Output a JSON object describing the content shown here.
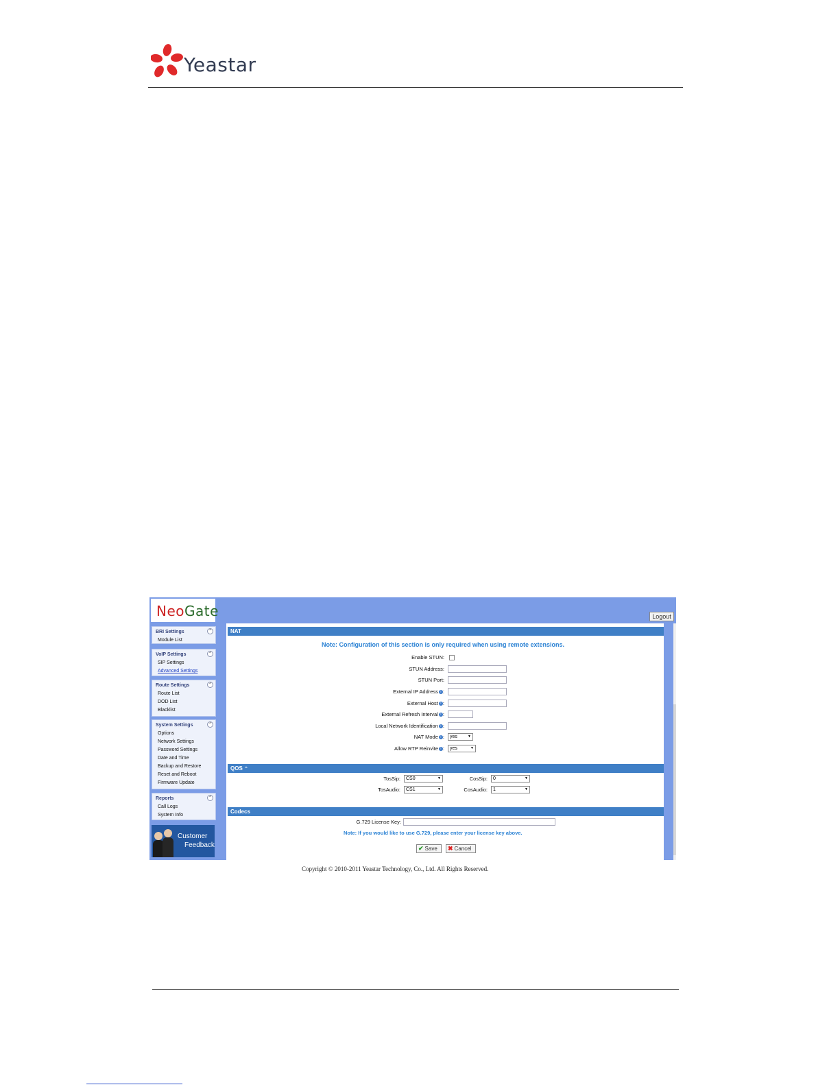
{
  "doc": {
    "brand": "Yeastar",
    "copyright": "Copyright © 2010-2011 Yeastar Technology, Co., Ltd. All Rights Reserved."
  },
  "ui": {
    "product_logo": {
      "part1": "Neo",
      "part2": "Gate"
    },
    "logout_label": "Logout",
    "sidebar": [
      {
        "title": "BRI Settings",
        "items": [
          {
            "label": "Module List",
            "link": false
          }
        ]
      },
      {
        "title": "VoIP Settings",
        "items": [
          {
            "label": "SIP Settings",
            "link": false
          },
          {
            "label": "Advanced Settings",
            "link": true
          }
        ]
      },
      {
        "title": "Route Settings",
        "items": [
          {
            "label": "Route List",
            "link": false
          },
          {
            "label": "DOD List",
            "link": false
          },
          {
            "label": "Blacklist",
            "link": false
          }
        ]
      },
      {
        "title": "System Settings",
        "items": [
          {
            "label": "Options",
            "link": false
          },
          {
            "label": "Network Settings",
            "link": false
          },
          {
            "label": "Password Settings",
            "link": false
          },
          {
            "label": "Date and Time",
            "link": false
          },
          {
            "label": "Backup and Restore",
            "link": false
          },
          {
            "label": "Reset and Reboot",
            "link": false
          },
          {
            "label": "Firmware Update",
            "link": false
          }
        ]
      },
      {
        "title": "Reports",
        "items": [
          {
            "label": "Call Logs",
            "link": false
          },
          {
            "label": "System Info",
            "link": false
          }
        ]
      }
    ],
    "feedback": {
      "line1": "Customer",
      "line2": "Feedback"
    },
    "nat": {
      "title": "NAT",
      "note": "Note: Configuration of this section is only required when using remote extensions.",
      "enable_stun": "Enable STUN:",
      "stun_address": "STUN Address:",
      "stun_port": "STUN Port:",
      "external_ip": "External IP Address",
      "external_host": "External Host",
      "refresh_interval": "External Refresh Interval",
      "local_network": "Local Network Identification",
      "nat_mode": "NAT Mode",
      "nat_mode_value": "yes",
      "allow_rtp": "Allow RTP Reinvite",
      "allow_rtp_value": "yes"
    },
    "qos": {
      "title": "QOS",
      "tossip": "TosSip:",
      "tossip_value": "CS0",
      "cossip": "CosSip:",
      "cossip_value": "0",
      "tosaudio": "TosAudio:",
      "tosaudio_value": "CS1",
      "cosaudio": "CosAudio:",
      "cosaudio_value": "1"
    },
    "codecs": {
      "title": "Codecs",
      "license_label": "G.729 License Key:",
      "note": "Note: If you would like to use G.729, please enter your license key above."
    },
    "save_label": "Save",
    "cancel_label": "Cancel"
  },
  "colors": {
    "banner": "#7b9ce6",
    "section_header": "#3f7fc6",
    "note_text": "#2b82d4",
    "logo_petal": "#e0292a"
  }
}
